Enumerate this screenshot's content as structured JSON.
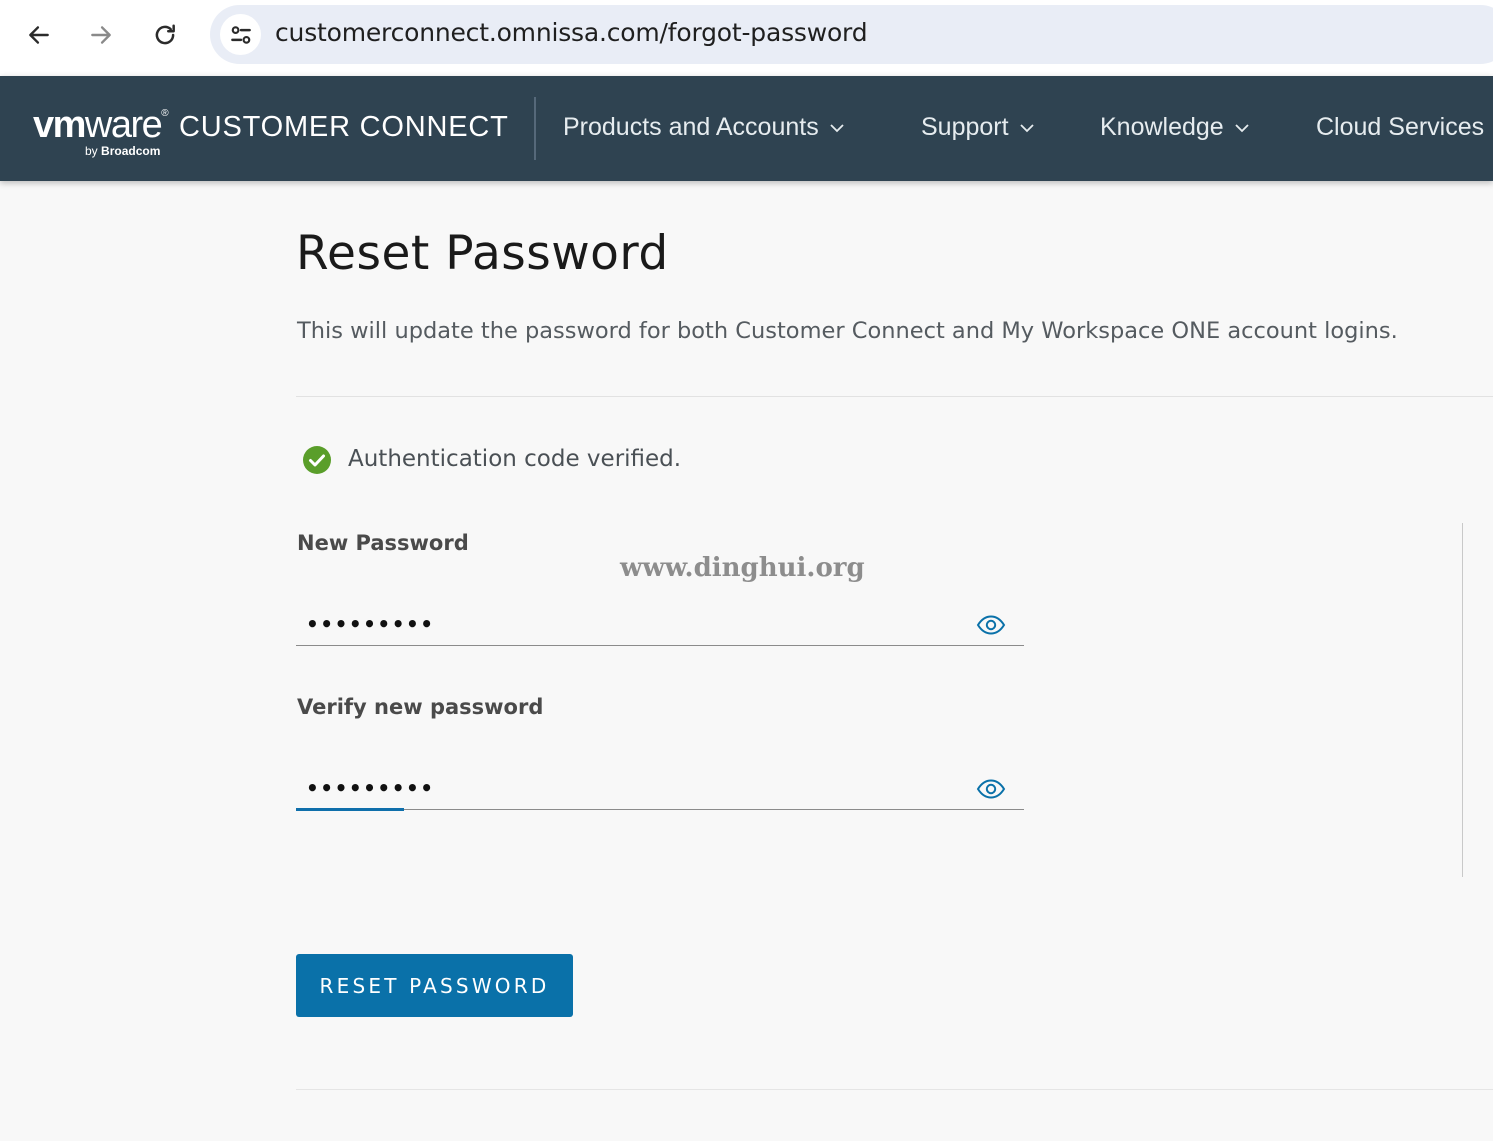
{
  "browser": {
    "url": "customerconnect.omnissa.com/forgot-password",
    "icons": [
      "back-arrow-icon",
      "forward-arrow-icon",
      "reload-icon",
      "site-settings-icon"
    ]
  },
  "header": {
    "logo_vm": "vm",
    "logo_ware": "ware",
    "logo_reg": "®",
    "logo_title": "CUSTOMER CONNECT",
    "logo_by": "by",
    "logo_broadcom": "Broadcom",
    "nav": [
      {
        "label": "Products and Accounts",
        "icon": "chevron-down-icon"
      },
      {
        "label": "Support",
        "icon": "chevron-down-icon"
      },
      {
        "label": "Knowledge",
        "icon": "chevron-down-icon"
      },
      {
        "label": "Cloud Services"
      }
    ]
  },
  "main": {
    "title": "Reset Password",
    "description": "This will update the password for both Customer Connect and My Workspace ONE account logins.",
    "verified_text": "Authentication code verified.",
    "new_password_label": "New Password",
    "new_password_value": "•••••••••",
    "verify_password_label": "Verify new password",
    "verify_password_value": "•••••••••",
    "watermark": "www.dinghui.org",
    "reset_button": "RESET PASSWORD"
  },
  "colors": {
    "header_bg": "#2f4351",
    "accent": "#0a71a9",
    "success": "#5a9e2a",
    "page_bg": "#f8f8f8"
  }
}
